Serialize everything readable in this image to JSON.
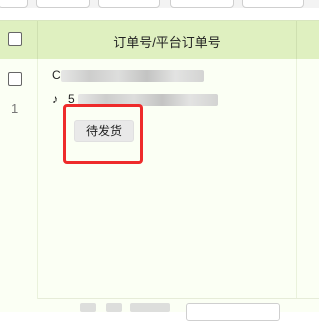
{
  "header": {
    "order_column_title": "订单号/平台订单号"
  },
  "row": {
    "index": "1",
    "order_prefix": "C",
    "platform_order_prefix": "5",
    "status_button": "待发货"
  },
  "colors": {
    "header_bg": "#dff0c0",
    "body_bg": "#fbfff4",
    "highlight": "#ee2b2b"
  }
}
